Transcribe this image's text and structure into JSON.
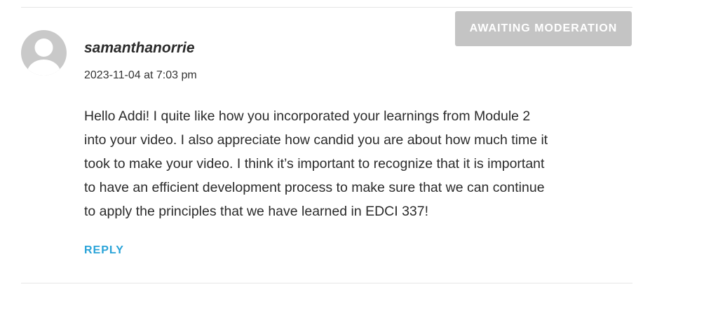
{
  "comment": {
    "badge": "AWAITING MODERATION",
    "author": "samanthanorrie",
    "timestamp": "2023-11-04 at 7:03 pm",
    "body_lines": [
      "Hello Addi! I quite like how you incorporated your learnings from Module 2",
      "into your video. I also appreciate how candid you are about how much time it",
      "took to make your video. I think it’s important to recognize that it is important",
      "to have an efficient development process to make sure that we can continue",
      "to apply the principles that we have learned in EDCI 337!"
    ],
    "reply_label": "REPLY",
    "avatar_icon": "default-user-avatar-icon"
  },
  "colors": {
    "badge_bg": "#c4c4c4",
    "reply_link": "#29a3d8",
    "avatar_bg": "#c9c9c9"
  }
}
